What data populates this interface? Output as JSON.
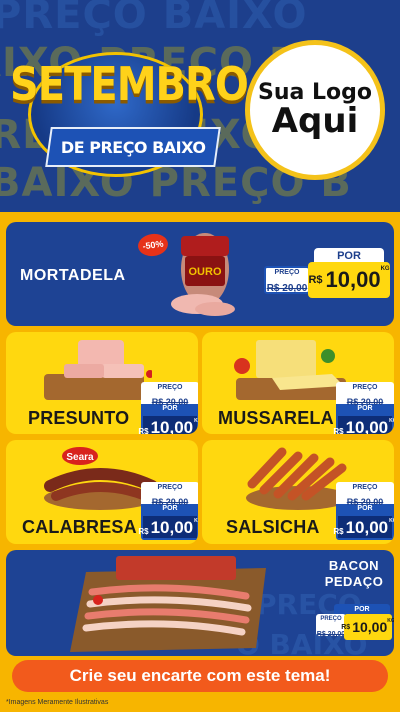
{
  "header": {
    "bg_line_1": "PREÇO BAIXO",
    "bg_line_2": "AIXO PREÇO B",
    "bg_line_3": "PREÇO BAIXO",
    "bg_line_4": "BAIXO PREÇO B",
    "title": "SETEMBRO",
    "subtitle": "DE PREÇO BAIXO",
    "logo_line1": "Sua Logo",
    "logo_line2": "Aqui"
  },
  "featured": {
    "name": "MORTADELA",
    "discount": "-50%",
    "brand_label": "OURO",
    "old_label": "PREÇO",
    "old_price": "R$ 20,00",
    "por_label": "POR",
    "currency": "R$",
    "new_price": "10,00",
    "unit": "KG"
  },
  "products": [
    {
      "name": "PRESUNTO",
      "old_label": "PREÇO",
      "old_price": "R$ 20,00",
      "por_label": "POR",
      "currency": "R$",
      "new_price": "10,00",
      "unit": "KG"
    },
    {
      "name": "MUSSARELA",
      "old_label": "PREÇO",
      "old_price": "R$ 20,00",
      "por_label": "POR",
      "currency": "R$",
      "new_price": "10,00",
      "unit": "KG"
    },
    {
      "name": "CALABRESA",
      "brand": "Seara",
      "old_label": "PREÇO",
      "old_price": "R$ 20,00",
      "por_label": "POR",
      "currency": "R$",
      "new_price": "10,00",
      "unit": "KG"
    },
    {
      "name": "SALSICHA",
      "old_label": "PREÇO",
      "old_price": "R$ 20,00",
      "por_label": "POR",
      "currency": "R$",
      "new_price": "10,00",
      "unit": "KG"
    }
  ],
  "bacon": {
    "name_line1": "BACON",
    "name_line2": "PEDAÇO",
    "old_label": "PREÇO",
    "old_price": "R$ 20,00",
    "por_label": "POR",
    "currency": "R$",
    "new_price": "10,00",
    "unit": "KG",
    "bg_text_1": "PREÇO",
    "bg_text_2": "O BAIXO"
  },
  "cta": "Crie seu encarte com este tema!",
  "disclaimer": "*Imagens Meramente Ilustrativas",
  "colors": {
    "blue": "#1e4394",
    "yellow": "#ffd80f",
    "orange": "#f25a1c",
    "page_bg": "#f7b500"
  }
}
